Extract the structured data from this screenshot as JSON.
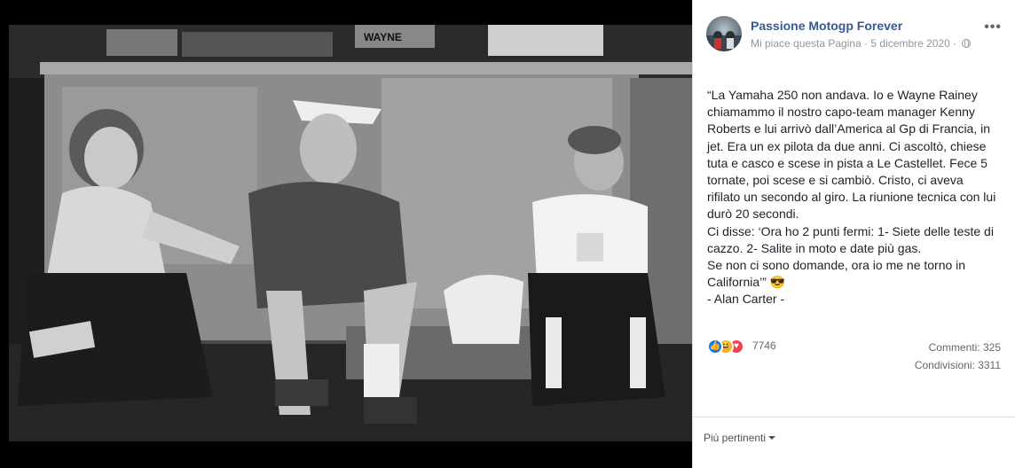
{
  "post": {
    "page_name": "Passione Motogp Forever",
    "like_page": "Mi piace questa Pagina",
    "separator": " · ",
    "date": "5 dicembre 2020",
    "text": "“La Yamaha 250 non andava. Io e Wayne Rainey chiamammo il nostro capo-team manager Kenny Roberts e lui arrivò dall’America al Gp di Francia, in jet. Era un ex pilota da due anni. Ci ascoltò, chiese tuta e casco e scese in pista a Le Castellet. Fece 5 tornate, poi scese e si cambiò. Cristo, ci aveva rifilato un secondo al giro. La riunione tecnica con lui durò 20 secondi.\nCi disse: ‘Ora ho 2 punti fermi: 1- Siete delle teste di cazzo. 2- Salite in moto e date più gas.\nSe non ci sono domande, ora io me ne torno in California’” 😎\n- Alan Carter -"
  },
  "photo": {
    "helmet_visor_text": "WAYNE"
  },
  "reactions": {
    "icons": [
      "like-icon",
      "haha-icon",
      "love-icon"
    ],
    "like_glyph": "👍",
    "haha_glyph": "😆",
    "love_glyph": "♥",
    "count": "7746"
  },
  "stats": {
    "comments": "Commenti: 325",
    "shares": "Condivisioni: 3311"
  },
  "footer": {
    "more_relevant": "Più pertinenti"
  },
  "colors": {
    "link": "#365899",
    "meta": "#90949c",
    "text": "#1d2129"
  }
}
